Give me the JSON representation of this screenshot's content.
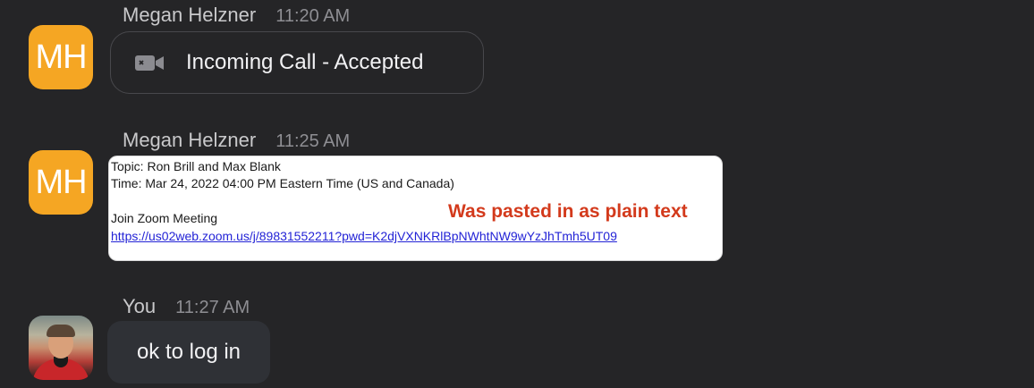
{
  "messages": [
    {
      "sender": "Megan Helzner",
      "initials": "MH",
      "time": "11:20 AM",
      "type": "call",
      "icon": "video-camera-icon",
      "text": "Incoming Call - Accepted"
    },
    {
      "sender": "Megan Helzner",
      "initials": "MH",
      "time": "11:25 AM",
      "type": "pasted-image",
      "lines": {
        "topic": "Topic: Ron Brill and Max Blank",
        "time": "Time: Mar 24, 2022 04:00 PM Eastern Time (US and Canada)",
        "join": "Join Zoom Meeting",
        "link": "https://us02web.zoom.us/j/89831552211?pwd=K2djVXNKRlBpNWhtNW9wYzJhTmh5UT09"
      },
      "annotation": "Was pasted in as plain text"
    },
    {
      "sender": "You",
      "time": "11:27 AM",
      "type": "text",
      "avatar": "user-photo",
      "text": "ok to log in"
    }
  ],
  "colors": {
    "background": "#252527",
    "avatar": "#f5a623",
    "annotation": "#d33a1c",
    "link": "#2323d6"
  }
}
